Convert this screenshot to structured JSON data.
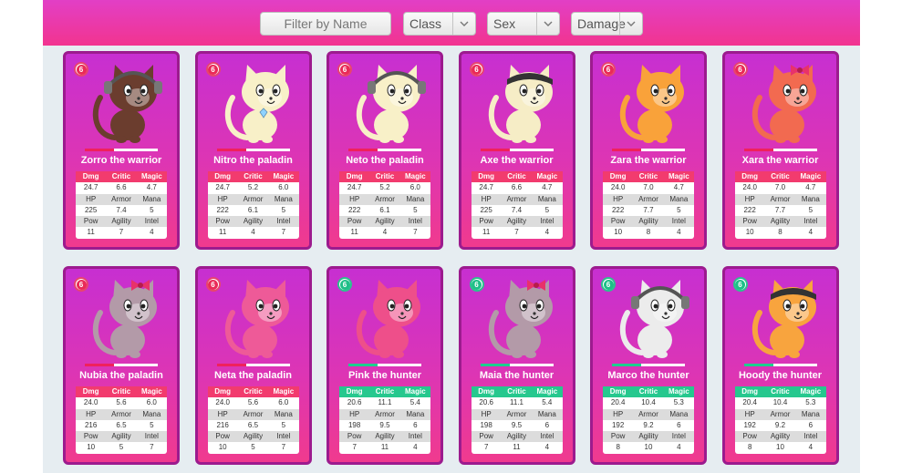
{
  "filters": {
    "name_placeholder": "Filter by Name",
    "class_label": "Class",
    "sex_label": "Sex",
    "damage_label": "Damage"
  },
  "stat_labels": {
    "row1": [
      "Dmg",
      "Critic",
      "Magic"
    ],
    "row2": [
      "HP",
      "Armor",
      "Mana"
    ],
    "row3": [
      "Pow",
      "Agility",
      "Intel"
    ]
  },
  "colors": {
    "warrior_accent": "#ea2a58",
    "hunter_accent": "#1fbf88"
  },
  "cards": [
    {
      "level": "6",
      "name": "Zorro the warrior",
      "type": "warrior",
      "health": 0.4,
      "dmg": "24.7",
      "critic": "6.6",
      "magic": "4.7",
      "hp": "225",
      "armor": "7.4",
      "mana": "5",
      "pow": "11",
      "agility": "7",
      "intel": "4",
      "body_color": "#6b3d2e",
      "accessory": "headphones"
    },
    {
      "level": "6",
      "name": "Nitro the paladin",
      "type": "warrior",
      "health": 0.4,
      "dmg": "24.7",
      "critic": "5.2",
      "magic": "6.0",
      "hp": "222",
      "armor": "6.1",
      "mana": "5",
      "pow": "11",
      "agility": "4",
      "intel": "7",
      "body_color": "#f8f0c8",
      "accessory": "gem"
    },
    {
      "level": "6",
      "name": "Neto the paladin",
      "type": "warrior",
      "health": 0.4,
      "dmg": "24.7",
      "critic": "5.2",
      "magic": "6.0",
      "hp": "222",
      "armor": "6.1",
      "mana": "5",
      "pow": "11",
      "agility": "4",
      "intel": "7",
      "body_color": "#f8f0c8",
      "accessory": "headphones"
    },
    {
      "level": "6",
      "name": "Axe the warrior",
      "type": "warrior",
      "health": 0.4,
      "dmg": "24.7",
      "critic": "6.6",
      "magic": "4.7",
      "hp": "225",
      "armor": "7.4",
      "mana": "5",
      "pow": "11",
      "agility": "7",
      "intel": "4",
      "body_color": "#f6edc6",
      "accessory": "bandana"
    },
    {
      "level": "6",
      "name": "Zara the warrior",
      "type": "warrior",
      "health": 0.4,
      "dmg": "24.0",
      "critic": "7.0",
      "magic": "4.7",
      "hp": "222",
      "armor": "7.7",
      "mana": "5",
      "pow": "10",
      "agility": "8",
      "intel": "4",
      "body_color": "#f9a23a",
      "accessory": "none"
    },
    {
      "level": "6",
      "name": "Xara the warrior",
      "type": "warrior",
      "health": 0.4,
      "dmg": "24.0",
      "critic": "7.0",
      "magic": "4.7",
      "hp": "222",
      "armor": "7.7",
      "mana": "5",
      "pow": "10",
      "agility": "8",
      "intel": "4",
      "body_color": "#f26a50",
      "accessory": "bow"
    },
    {
      "level": "6",
      "name": "Nubia the paladin",
      "type": "warrior",
      "health": 0.4,
      "dmg": "24.0",
      "critic": "5.6",
      "magic": "6.0",
      "hp": "216",
      "armor": "6.5",
      "mana": "5",
      "pow": "10",
      "agility": "5",
      "intel": "7",
      "body_color": "#b39aa8",
      "accessory": "bow"
    },
    {
      "level": "6",
      "name": "Neta the paladin",
      "type": "warrior",
      "health": 0.4,
      "dmg": "24.0",
      "critic": "5.6",
      "magic": "6.0",
      "hp": "216",
      "armor": "6.5",
      "mana": "5",
      "pow": "10",
      "agility": "5",
      "intel": "7",
      "body_color": "#ee5a98",
      "accessory": "none"
    },
    {
      "level": "6",
      "name": "Pink the hunter",
      "type": "hunter",
      "health": 0.4,
      "dmg": "20.6",
      "critic": "11.1",
      "magic": "5.4",
      "hp": "198",
      "armor": "9.5",
      "mana": "6",
      "pow": "7",
      "agility": "11",
      "intel": "4",
      "body_color": "#ee4f8a",
      "accessory": "none"
    },
    {
      "level": "6",
      "name": "Maia the hunter",
      "type": "hunter",
      "health": 0.4,
      "dmg": "20.6",
      "critic": "11.1",
      "magic": "5.4",
      "hp": "198",
      "armor": "9.5",
      "mana": "6",
      "pow": "7",
      "agility": "11",
      "intel": "4",
      "body_color": "#b39aa8",
      "accessory": "bow"
    },
    {
      "level": "6",
      "name": "Marco the hunter",
      "type": "hunter",
      "health": 0.4,
      "dmg": "20.4",
      "critic": "10.4",
      "magic": "5.3",
      "hp": "192",
      "armor": "9.2",
      "mana": "6",
      "pow": "8",
      "agility": "10",
      "intel": "4",
      "body_color": "#ececec",
      "accessory": "headphones"
    },
    {
      "level": "6",
      "name": "Hoody the hunter",
      "type": "hunter",
      "health": 0.4,
      "dmg": "20.4",
      "critic": "10.4",
      "magic": "5.3",
      "hp": "192",
      "armor": "9.2",
      "mana": "6",
      "pow": "8",
      "agility": "10",
      "intel": "4",
      "body_color": "#f8a43e",
      "accessory": "bandana"
    }
  ]
}
